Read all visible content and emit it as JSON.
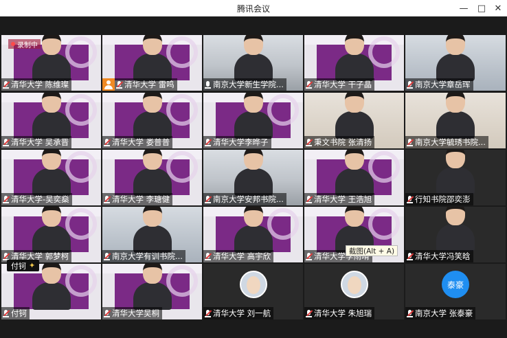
{
  "window": {
    "title": "腾讯会议",
    "minimize_icon": "minimize-icon",
    "maximize_icon": "maximize-icon",
    "close_icon": "close-icon"
  },
  "recording_badge": "录制中",
  "speaking_tag": {
    "name": "付钶",
    "icon": "party-popper-icon"
  },
  "tooltip": "截图(Alt + A)",
  "colors": {
    "slide_purple": "#7b2a86",
    "avatar_blue": "#1f8ef1",
    "stage_bg": "#1b1b1b"
  },
  "tiles": [
    {
      "name": "清华大学 陈维璨"
    },
    {
      "name": "清华大学 雷鸣"
    },
    {
      "name": "南京大学新生学院..."
    },
    {
      "name": "清华大学 干子晶"
    },
    {
      "name": "南京大学章岳珲"
    },
    {
      "name": "清华大学 吴承晋"
    },
    {
      "name": "清华大学 娄普普"
    },
    {
      "name": "清华大学李晔子"
    },
    {
      "name": "秉文书院 张清扬"
    },
    {
      "name": "南京大学毓琇书院..."
    },
    {
      "name": "清华大学-吴奕燊"
    },
    {
      "name": "清华大学 李瑭健"
    },
    {
      "name": "南京大学安邦书院..."
    },
    {
      "name": "清华大学 王浩旭"
    },
    {
      "name": "行知书院邵奕澎"
    },
    {
      "name": "清华大学 郭梦柯"
    },
    {
      "name": "南京大学有训书院..."
    },
    {
      "name": "清华大学  高宇欣"
    },
    {
      "name": "清华大学李雨晴"
    },
    {
      "name": "清华大学冯笑晗"
    },
    {
      "name": "付钶"
    },
    {
      "name": "清华大学吴桐"
    },
    {
      "name": "清华大学 刘一航"
    },
    {
      "name": "清华大学 朱旭瑞"
    },
    {
      "name": "南京大学 张泰豪",
      "avatar_text": "泰豪"
    }
  ]
}
